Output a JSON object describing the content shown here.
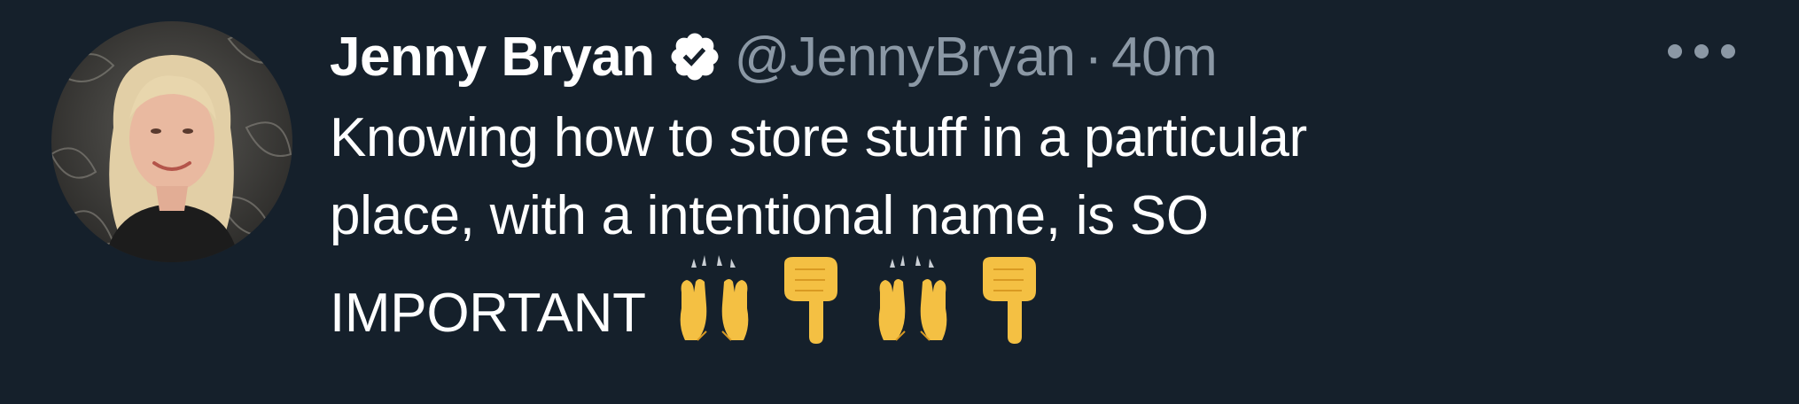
{
  "tweet": {
    "display_name": "Jenny Bryan",
    "handle": "@JennyBryan",
    "separator": "·",
    "time": "40m",
    "text_line1": "Knowing how to store stuff in a particular",
    "text_line2": "place, with a intentional name, is SO",
    "text_line3": "IMPORTANT",
    "emojis": [
      "raising-hands-icon",
      "pointing-down-icon",
      "raising-hands-icon",
      "pointing-down-icon"
    ]
  },
  "icons": {
    "verified": "verified-badge-icon",
    "more": "more-options-icon"
  },
  "colors": {
    "background": "#15202b",
    "text_primary": "#ffffff",
    "text_secondary": "#8b98a5",
    "emoji_yellow": "#f4c043"
  }
}
